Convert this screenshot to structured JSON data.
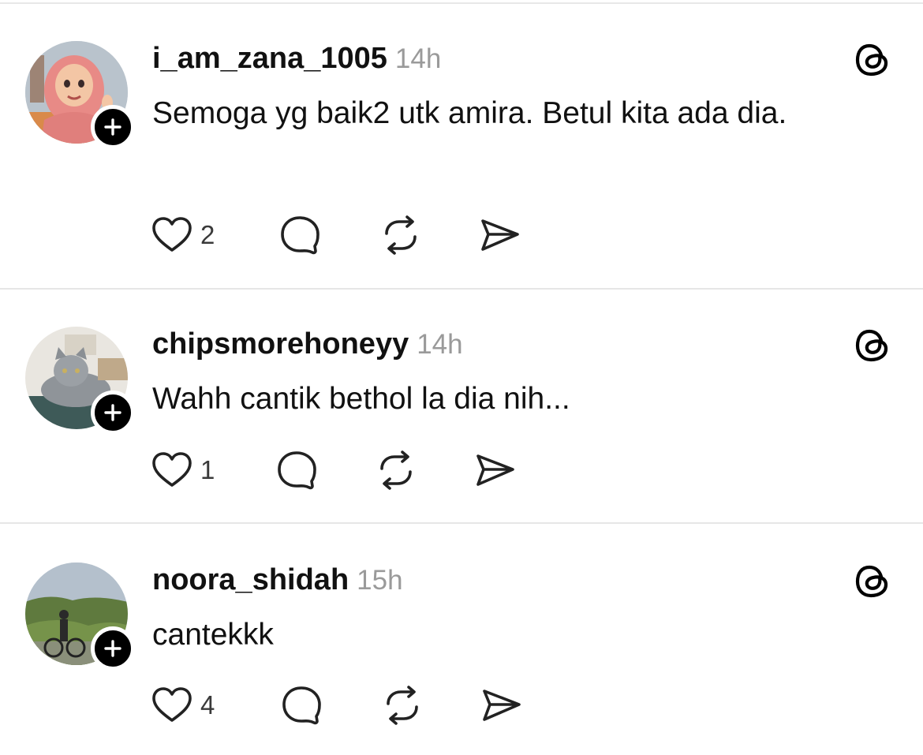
{
  "posts": [
    {
      "username": "i_am_zana_1005",
      "time": "14h",
      "text": "Semoga yg baik2 utk amira. Betul kita ada dia.",
      "likes": "2"
    },
    {
      "username": "chipsmorehoneyy",
      "time": "14h",
      "text": "Wahh cantik bethol la dia nih...",
      "likes": "1"
    },
    {
      "username": "noora_shidah",
      "time": "15h",
      "text": "cantekkk",
      "likes": "4"
    }
  ],
  "icons": {
    "like": "heart-icon",
    "reply": "comment-bubble-icon",
    "repost": "repost-icon",
    "share": "send-icon",
    "brand": "threads-logo-icon",
    "follow": "plus-icon"
  },
  "colors": {
    "text": "#111111",
    "muted": "#9a9a9a",
    "divider": "#e6e6e6",
    "badge": "#000000"
  }
}
